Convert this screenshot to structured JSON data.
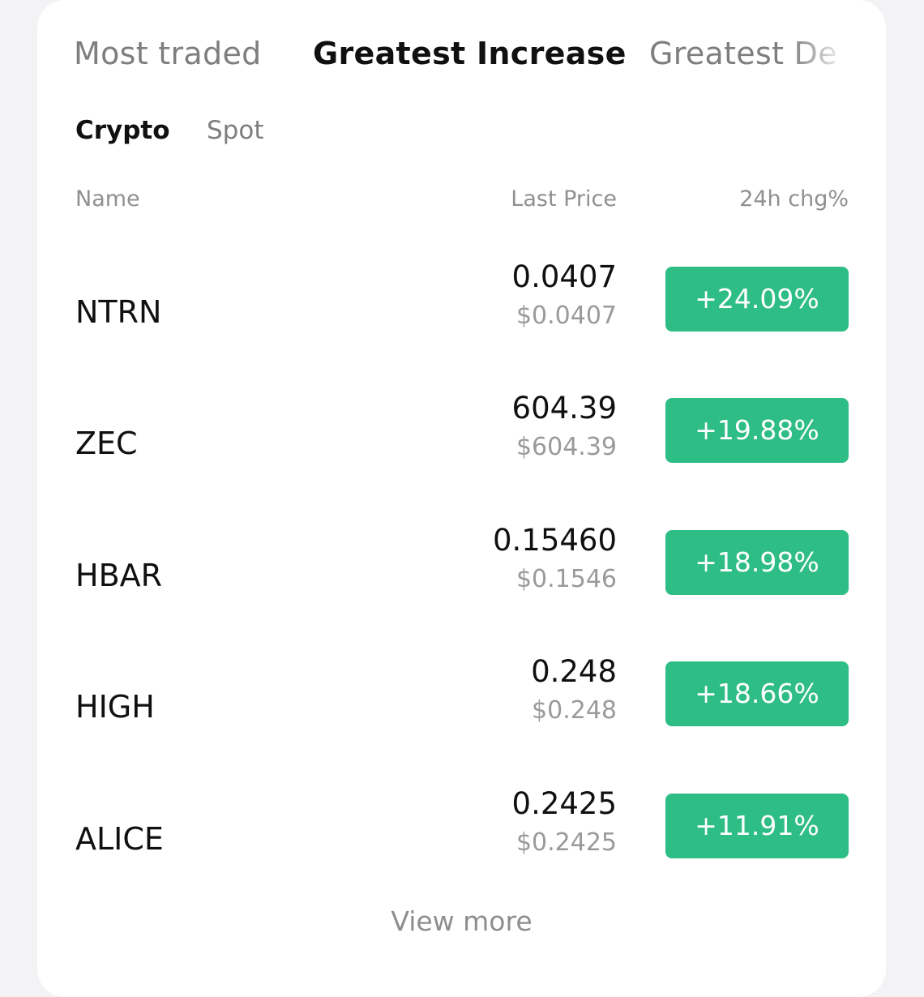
{
  "tabs": {
    "most_traded": "Most traded",
    "greatest_increase": "Greatest Increase",
    "greatest_decrease": "Greatest De"
  },
  "subtabs": {
    "crypto": "Crypto",
    "spot": "Spot"
  },
  "columns": {
    "name": "Name",
    "last_price": "Last Price",
    "change": "24h chg%"
  },
  "rows": [
    {
      "name": "NTRN",
      "price": "0.0407",
      "fiat": "$0.0407",
      "change": "+24.09%"
    },
    {
      "name": "ZEC",
      "price": "604.39",
      "fiat": "$604.39",
      "change": "+19.88%"
    },
    {
      "name": "HBAR",
      "price": "0.15460",
      "fiat": "$0.1546",
      "change": "+18.98%"
    },
    {
      "name": "HIGH",
      "price": "0.248",
      "fiat": "$0.248",
      "change": "+18.66%"
    },
    {
      "name": "ALICE",
      "price": "0.2425",
      "fiat": "$0.2425",
      "change": "+11.91%"
    }
  ],
  "view_more": "View more",
  "colors": {
    "positive": "#2ebd85",
    "active_text": "#101010",
    "inactive_text": "#7e7e7e"
  }
}
